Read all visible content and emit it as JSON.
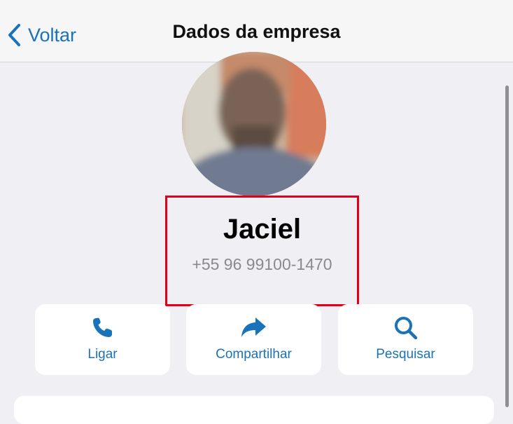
{
  "nav": {
    "back_label": "Voltar",
    "title": "Dados da empresa"
  },
  "contact": {
    "name": "Jaciel",
    "phone": "+55 96 99100-1470",
    "avatar_icon": "profile-photo-blurred"
  },
  "actions": [
    {
      "label": "Ligar",
      "icon": "phone-icon"
    },
    {
      "label": "Compartilhar",
      "icon": "share-icon"
    },
    {
      "label": "Pesquisar",
      "icon": "search-icon"
    }
  ],
  "colors": {
    "accent": "#1a73b8",
    "highlight_border": "#e0001a",
    "background": "#efeff4",
    "secondary_text": "#8a8a8e"
  }
}
